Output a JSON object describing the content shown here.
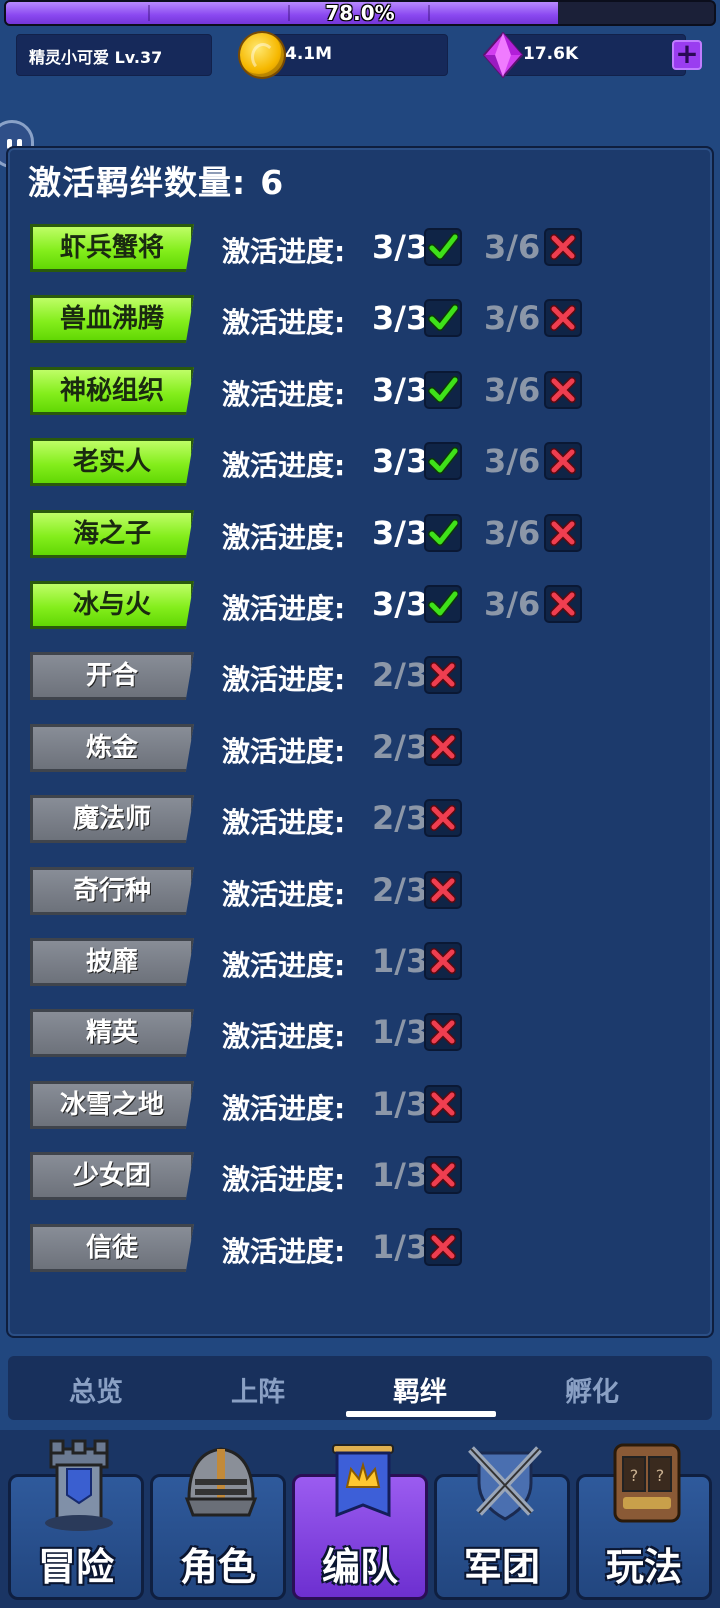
{
  "xp": {
    "percent_label": "78.0%",
    "fraction": 0.78
  },
  "player": {
    "name_level": "精灵小可爱 Lv.37"
  },
  "currency": {
    "coins": "4.1M",
    "gems": "17.6K"
  },
  "panel": {
    "title": "激活羁绊数量:",
    "count": "6",
    "progress_label": "激活进度:",
    "bonds": [
      {
        "name": "虾兵蟹将",
        "active": true,
        "progress": "3/3",
        "progress2": "3/6"
      },
      {
        "name": "兽血沸腾",
        "active": true,
        "progress": "3/3",
        "progress2": "3/6"
      },
      {
        "name": "神秘组织",
        "active": true,
        "progress": "3/3",
        "progress2": "3/6"
      },
      {
        "name": "老实人",
        "active": true,
        "progress": "3/3",
        "progress2": "3/6"
      },
      {
        "name": "海之子",
        "active": true,
        "progress": "3/3",
        "progress2": "3/6"
      },
      {
        "name": "冰与火",
        "active": true,
        "progress": "3/3",
        "progress2": "3/6"
      },
      {
        "name": "开合",
        "active": false,
        "progress": "2/3"
      },
      {
        "name": "炼金",
        "active": false,
        "progress": "2/3"
      },
      {
        "name": "魔法师",
        "active": false,
        "progress": "2/3"
      },
      {
        "name": "奇行种",
        "active": false,
        "progress": "2/3"
      },
      {
        "name": "披靡",
        "active": false,
        "progress": "1/3"
      },
      {
        "name": "精英",
        "active": false,
        "progress": "1/3"
      },
      {
        "name": "冰雪之地",
        "active": false,
        "progress": "1/3"
      },
      {
        "name": "少女团",
        "active": false,
        "progress": "1/3"
      },
      {
        "name": "信徒",
        "active": false,
        "progress": "1/3"
      }
    ]
  },
  "subtabs": [
    {
      "label": "总览",
      "selected": false
    },
    {
      "label": "上阵",
      "selected": false
    },
    {
      "label": "羁绊",
      "selected": true
    },
    {
      "label": "孵化",
      "selected": false
    }
  ],
  "nav": [
    {
      "label": "冒险",
      "icon": "tower-icon",
      "selected": false
    },
    {
      "label": "角色",
      "icon": "knight-helmet-icon",
      "selected": false
    },
    {
      "label": "编队",
      "icon": "crown-banner-icon",
      "selected": true
    },
    {
      "label": "军团",
      "icon": "crossed-swords-shield-icon",
      "selected": false
    },
    {
      "label": "玩法",
      "icon": "lucky-slot-machine-icon",
      "selected": false
    }
  ],
  "colors": {
    "background": "#21477f",
    "active_bond": "#84ee1c",
    "inactive_bond": "#7a7f88",
    "check": "#38e01a",
    "cross": "#e83a4a",
    "selected_nav": "#8a48f0"
  }
}
